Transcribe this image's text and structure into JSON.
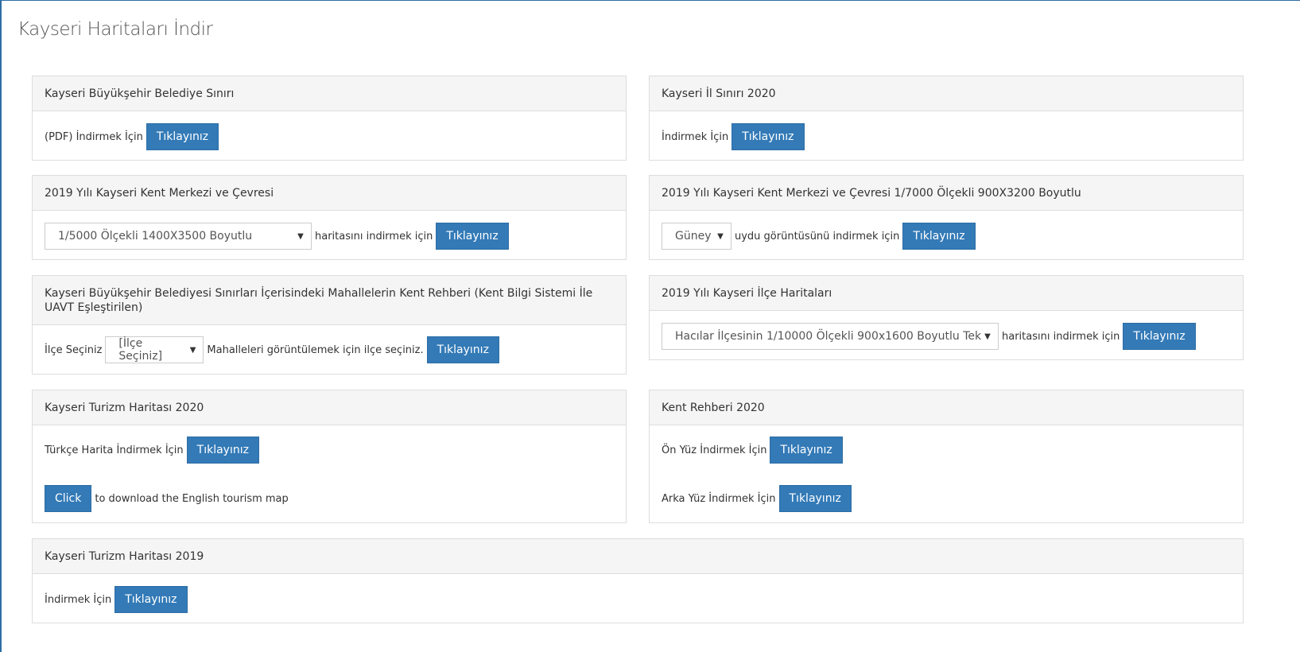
{
  "page": {
    "title": "Kayseri Haritaları İndir"
  },
  "button_label": "Tıklayınız",
  "panels": {
    "p1": {
      "title": "Kayseri Büyükşehir Belediye Sınırı",
      "text": "(PDF) İndirmek İçin"
    },
    "p2": {
      "title": "Kayseri İl Sınırı 2020",
      "text": "İndirmek İçin"
    },
    "p3": {
      "title": "2019 Yılı Kayseri Kent Merkezi ve Çevresi",
      "select": "1/5000 Ölçekli 1400X3500 Boyutlu",
      "text": "haritasını indirmek için"
    },
    "p4": {
      "title": "2019 Yılı Kayseri Kent Merkezi ve Çevresi 1/7000 Ölçekli 900X3200 Boyutlu",
      "select": "Güney",
      "text": "uydu görüntüsünü indirmek için"
    },
    "p5": {
      "title": "Kayseri Büyükşehir Belediyesi Sınırları İçerisindeki Mahallelerin Kent Rehberi (Kent Bilgi Sistemi İle UAVT Eşleştirilen)",
      "label": "İlçe Seçiniz",
      "select": "[İlçe Seçiniz]",
      "text": "Mahalleleri görüntülemek için ilçe seçiniz."
    },
    "p6": {
      "title": "2019 Yılı Kayseri İlçe Haritaları",
      "select": "Hacılar İlçesinin 1/10000 Ölçekli 900x1600 Boyutlu Tek",
      "text": "haritasını indirmek için"
    },
    "p7": {
      "title": "Kayseri Turizm Haritası 2020",
      "text_tr": "Türkçe Harita İndirmek İçin",
      "click_label": "Click",
      "text_en": "to download the English tourism map"
    },
    "p8": {
      "title": "Kent Rehberi 2020",
      "text_front": "Ön Yüz İndirmek İçin",
      "text_back": "Arka Yüz İndirmek İçin"
    },
    "p9": {
      "title": "Kayseri Turizm Haritası 2019",
      "text": "İndirmek İçin"
    }
  }
}
